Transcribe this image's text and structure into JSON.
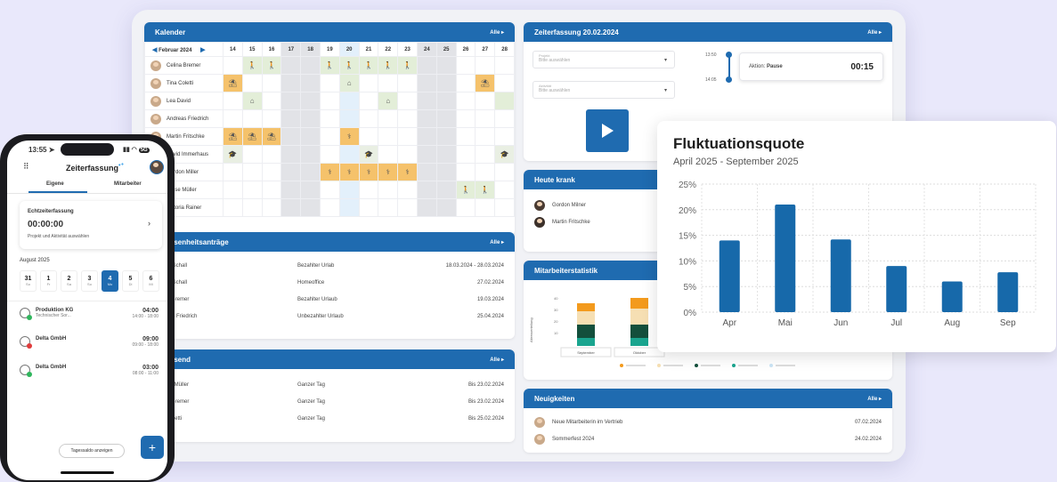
{
  "colors": {
    "accent": "#1f6bb0",
    "vacation": "#f5c26b",
    "homeoffice": "#e3eed8"
  },
  "calendar": {
    "title": "Kalender",
    "alle": "Alle",
    "month": "Februar 2024",
    "days": [
      "14",
      "15",
      "16",
      "17",
      "18",
      "19",
      "20",
      "21",
      "22",
      "23",
      "24",
      "25",
      "26",
      "27",
      "28"
    ],
    "weekend_idx": [
      3,
      4,
      10,
      11
    ],
    "today_idx": 6,
    "rows": [
      {
        "name": "Celina Bremer",
        "cells": {
          "1": "walk",
          "2": "walk",
          "5": "walk",
          "6": "walk",
          "7": "walk",
          "8": "walk",
          "9": "walk"
        },
        "style": {
          "1": "g",
          "2": "g",
          "5": "g",
          "6": "g",
          "7": "g",
          "8": "g",
          "9": "g"
        }
      },
      {
        "name": "Tina Coletti",
        "cells": {
          "0": "sun",
          "6": "home",
          "13": "sun"
        },
        "style": {
          "0": "y",
          "6": "g",
          "13": "y"
        }
      },
      {
        "name": "Lea David",
        "cells": {
          "1": "home",
          "8": "home"
        },
        "style": {
          "1": "g",
          "8": "g",
          "14": "g"
        }
      },
      {
        "name": "Andreas Friedrich",
        "cells": {},
        "style": {}
      },
      {
        "name": "Martin Fritschke",
        "cells": {
          "0": "sun",
          "1": "sun",
          "2": "sun",
          "6": "med"
        },
        "style": {
          "0": "y",
          "1": "y",
          "2": "y",
          "6": "y"
        }
      },
      {
        "name": "David Immerhaus",
        "cells": {
          "0": "grad",
          "7": "grad",
          "14": "grad"
        },
        "style": {
          "0": "gr",
          "7": "gr",
          "14": "gr"
        }
      },
      {
        "name": "Gordon Miller",
        "cells": {
          "5": "med",
          "6": "med",
          "7": "med",
          "8": "med",
          "9": "med"
        },
        "style": {
          "5": "y",
          "6": "y",
          "7": "y",
          "8": "y",
          "9": "y"
        }
      },
      {
        "name": "Jesse Müller",
        "cells": {
          "12": "walk",
          "13": "walk"
        },
        "style": {
          "12": "g",
          "13": "g"
        }
      },
      {
        "name": "Viktoria Rainer",
        "cells": {},
        "style": {}
      }
    ]
  },
  "zeiterfassung": {
    "title": "Zeiterfassung 20.02.2024",
    "alle": "Alle",
    "projekt_label": "Projekt",
    "projekt_ph": "Bitte auswählen",
    "aktivitaet_label": "Aktivität",
    "aktivitaet_ph": "Bitte auswählen",
    "time_start": "13:50",
    "time_end": "14:05",
    "aktion_label": "Aktion:",
    "aktion_value": "Pause",
    "aktion_time": "00:15"
  },
  "abwesenheitsantraege": {
    "title": "Abwesenheitsanträge",
    "alle": "Alle",
    "rows": [
      {
        "name": "Robert Schall",
        "type": "Bezahlter Urlab",
        "date": "18.03.2024 - 28.03.2024"
      },
      {
        "name": "Robert Schall",
        "type": "Homeoffice",
        "date": "27.02.2024"
      },
      {
        "name": "Celina Bremer",
        "type": "Bezahlter Urlaub",
        "date": "19.03.2024"
      },
      {
        "name": "Andreas Friedrich",
        "type": "Unbezahlter Urlaub",
        "date": "25.04.2024"
      }
    ]
  },
  "abwesend": {
    "title": "Abwesend",
    "alle": "Alle",
    "rows": [
      {
        "name": "Gordon Müller",
        "type": "Ganzer Tag",
        "date": "Bis 23.02.2024"
      },
      {
        "name": "Celina Bremer",
        "type": "Ganzer Tag",
        "date": "Bis 23.02.2024"
      },
      {
        "name": "Tina Coletti",
        "type": "Ganzer Tag",
        "date": "Bis 25.02.2024"
      }
    ]
  },
  "heute_krank": {
    "title": "Heute krank",
    "rows": [
      "Gordon Milner",
      "Martin Fritschke"
    ]
  },
  "mitarbeiterstatistik": {
    "title": "Mitarbeiterstatistik",
    "ylabel": "Altersverteilung",
    "ticks": [
      "40",
      "30",
      "20",
      "10"
    ],
    "categories": [
      "September",
      "Oktober"
    ],
    "stack_colors": [
      "#1aa58f",
      "#134f3c",
      "#f6dfb3",
      "#f39a1d"
    ],
    "stacks": [
      [
        6,
        10,
        10,
        6
      ],
      [
        6,
        10,
        12,
        8
      ]
    ],
    "legend_colors": [
      "#f39a1d",
      "#f6dfb3",
      "#134f3c",
      "#1aa58f",
      "#cbe4f5"
    ]
  },
  "neuigkeiten": {
    "title": "Neuigkeiten",
    "alle": "Alle",
    "rows": [
      {
        "text": "Neue Mitarbeiterin im Vertrieb",
        "date": "07.02.2024"
      },
      {
        "text": "Sommerfest 2024",
        "date": "24.02.2024"
      }
    ]
  },
  "fluktuation": {
    "title": "Fluktuationsquote",
    "subtitle": "April 2025 - September 2025"
  },
  "chart_data": {
    "type": "bar",
    "title": "Fluktuationsquote",
    "subtitle": "April 2025 - September 2025",
    "categories": [
      "Apr",
      "Mai",
      "Jun",
      "Jul",
      "Aug",
      "Sep"
    ],
    "values": [
      14,
      21,
      14.2,
      9,
      6,
      7.8
    ],
    "ylim": [
      0,
      25
    ],
    "yticks": [
      "25%",
      "20%",
      "15%",
      "10%",
      "5%",
      "0%"
    ],
    "grid": true,
    "color": "#1769aa"
  },
  "phone": {
    "time": "13:55",
    "status": "5G",
    "title": "Zeiterfassung",
    "tab_eigene": "Eigene",
    "tab_mitarbeiter": "Mitarbeiter",
    "card_title": "Echtzeiterfassung",
    "card_time": "00:00:00",
    "card_sub": "Projekt und Aktivität auswählen",
    "month": "August 2025",
    "days": [
      {
        "n": "31",
        "d": "So"
      },
      {
        "n": "1",
        "d": "Fr"
      },
      {
        "n": "2",
        "d": "Sa"
      },
      {
        "n": "3",
        "d": "So"
      },
      {
        "n": "4",
        "d": "Mo"
      },
      {
        "n": "5",
        "d": "Di"
      },
      {
        "n": "6",
        "d": "Mi"
      }
    ],
    "active_day": 4,
    "entries": [
      {
        "title": "Produktion KG",
        "sub": "Technischer Sor...",
        "hours": "04:00",
        "range": "14:00 - 18:00",
        "dot": "#2fb55c"
      },
      {
        "title": "Delta GmbH",
        "sub": "",
        "hours": "09:00",
        "range": "09:00 - 18:00",
        "dot": "#e03c3c"
      },
      {
        "title": "Delta GmbH",
        "sub": "",
        "hours": "03:00",
        "range": "08:00 - 11:00",
        "dot": "#2fb55c"
      }
    ],
    "footer_button": "Tagessaldo anzeigen",
    "fab": "+"
  }
}
